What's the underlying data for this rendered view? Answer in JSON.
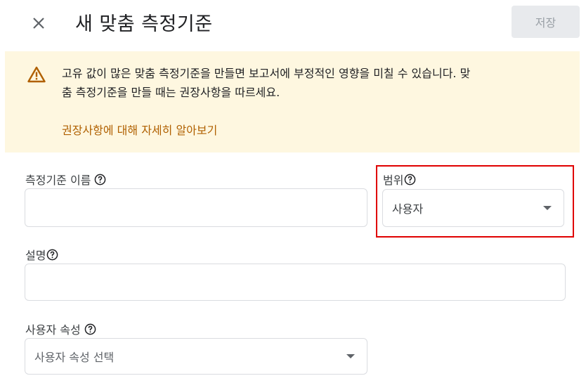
{
  "header": {
    "title": "새 맞춤 측정기준",
    "save_label": "저장",
    "close_icon": "close-icon"
  },
  "banner": {
    "icon": "warning-icon",
    "line1": "고유 값이 많은 맞춤 측정기준을 만들면 보고서에 부정적인 영향을 미칠 수 있습니다. 맞",
    "line2": "춤 측정기준을 만들 때는 권장사항을 따르세요.",
    "link": "권장사항에 대해 자세히 알아보기",
    "colors": {
      "background": "#fef7e0",
      "link": "#b06000",
      "icon": "#b06000"
    }
  },
  "form": {
    "dimension_name": {
      "label": "측정기준 이름",
      "value": ""
    },
    "scope": {
      "label": "범위",
      "value": "사용자"
    },
    "description": {
      "label": "설명",
      "value": ""
    },
    "user_property": {
      "label": "사용자 속성",
      "placeholder": "사용자 속성 선택"
    }
  },
  "highlight_color": "#e00000"
}
